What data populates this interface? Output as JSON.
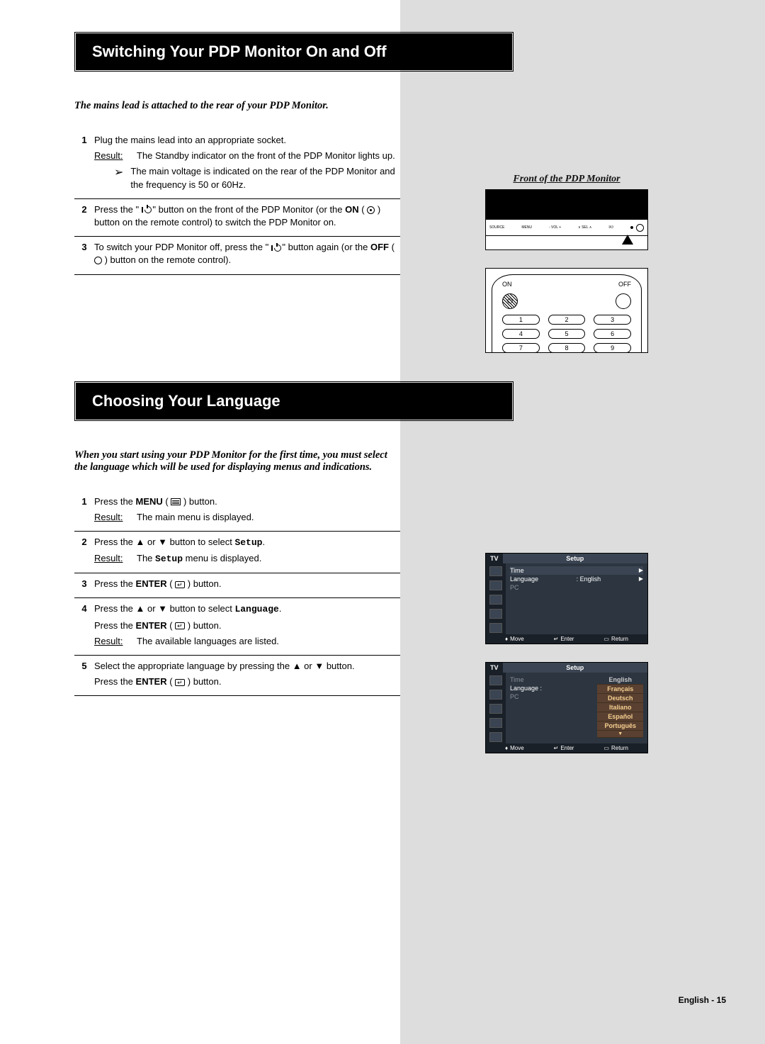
{
  "page_footer": "English - 15",
  "section1": {
    "title": "Switching Your PDP Monitor On and Off",
    "intro": "The mains lead is attached to the rear of your PDP Monitor.",
    "steps": {
      "s1": {
        "num": "1",
        "line": "Plug the mains lead into an appropriate socket.",
        "result_label": "Result:",
        "result_text": "The Standby indicator on the front of the PDP Monitor lights up.",
        "note": "The main voltage is indicated on the rear of the PDP Monitor and the frequency is 50 or 60Hz."
      },
      "s2": {
        "num": "2",
        "pre": "Press the \" ",
        "mid": " \" button on the front of the PDP Monitor (or the ",
        "on": "ON",
        "after": " ( ",
        "after2": " ) button on the remote control) to switch the PDP Monitor on."
      },
      "s3": {
        "num": "3",
        "pre": "To switch your PDP Monitor off, press the \" ",
        "mid": " \" button again (or the ",
        "off": "OFF",
        "after": " ( ",
        "after2": " ) button on the remote control)."
      }
    },
    "fig_title": "Front of the PDP Monitor",
    "panel_labels": [
      "SOURCE",
      "MENU",
      "- VOL +",
      "∨ SEL ∧",
      "I/⏻"
    ],
    "remote": {
      "on": "ON",
      "off": "OFF",
      "nums": [
        "1",
        "2",
        "3",
        "4",
        "5",
        "6",
        "7",
        "8",
        "9"
      ]
    }
  },
  "section2": {
    "title": "Choosing Your Language",
    "intro": "When you start using your PDP Monitor for the first time, you must select the language which will be used for displaying menus and indications.",
    "steps": {
      "s1": {
        "num": "1",
        "a": "Press the ",
        "b": "MENU",
        "c": " ( ",
        "d": " ) button.",
        "result_label": "Result:",
        "result_text": "The main menu is displayed."
      },
      "s2": {
        "num": "2",
        "a": "Press the ▲ or ▼ button to select ",
        "b": "Setup",
        "c": ".",
        "result_label": "Result:",
        "result_text_a": "The ",
        "result_text_b": "Setup",
        "result_text_c": " menu is displayed."
      },
      "s3": {
        "num": "3",
        "a": "Press the ",
        "b": "ENTER",
        "c": " ( ",
        "d": " ) button."
      },
      "s4": {
        "num": "4",
        "a": "Press the ▲ or ▼ button to select ",
        "b": "Language",
        "c": ".",
        "d": "Press the ",
        "e": "ENTER",
        "f": " ( ",
        "g": " ) button.",
        "result_label": "Result:",
        "result_text": "The available languages are listed."
      },
      "s5": {
        "num": "5",
        "a": "Select the appropriate language by pressing the ▲ or ▼ button.",
        "b": "Press the ",
        "c": "ENTER",
        "d": " ( ",
        "e": " ) button."
      }
    },
    "osd": {
      "tv": "TV",
      "title": "Setup",
      "rows": {
        "time": "Time",
        "language": "Language",
        "langval": ": English",
        "pc": "PC"
      },
      "foot": {
        "move": "Move",
        "enter": "Enter",
        "ret": "Return"
      },
      "langs": [
        "English",
        "Français",
        "Deutsch",
        "Italiano",
        "Español",
        "Português",
        "▼"
      ]
    }
  }
}
